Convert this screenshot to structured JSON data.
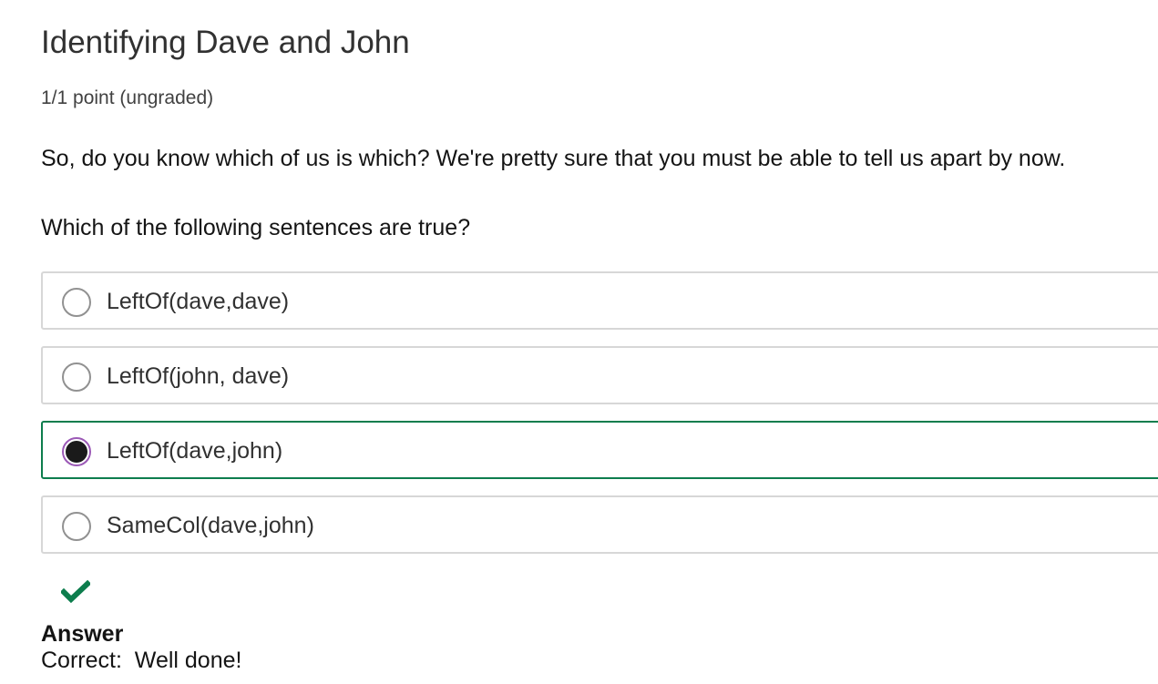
{
  "problem": {
    "title": "Identifying Dave and John",
    "points": "1/1 point (ungraded)",
    "prompt_1": "So, do you know which of us is which? We're pretty sure that you must be able to tell us apart by now.",
    "prompt_2": "Which of the following sentences are true?"
  },
  "choices": [
    {
      "label": "LeftOf(dave,dave)",
      "selected": false
    },
    {
      "label": "LeftOf(john, dave)",
      "selected": false
    },
    {
      "label": "LeftOf(dave,john)",
      "selected": true
    },
    {
      "label": "SameCol(dave,john)",
      "selected": false
    }
  ],
  "feedback": {
    "status_icon": "checkmark-icon",
    "answer_heading": "Answer",
    "answer_text": "Correct:  Well done!"
  },
  "colors": {
    "correct": "#0d7d4d",
    "radio_selected_ring": "#9b59b6"
  }
}
